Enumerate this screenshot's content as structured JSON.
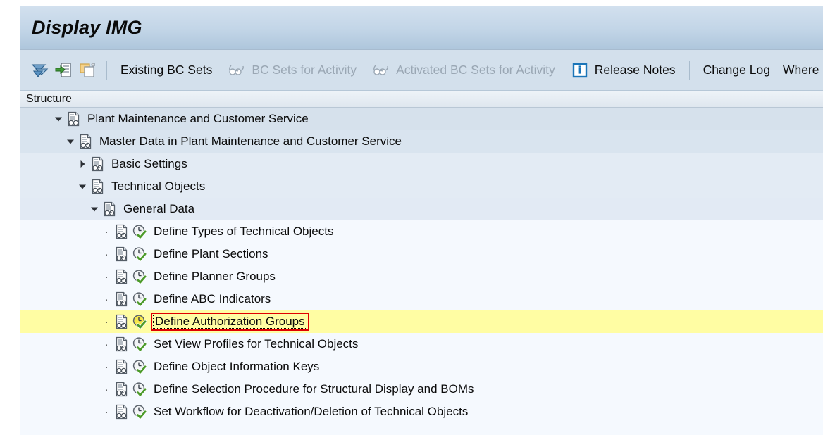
{
  "window": {
    "title": "Display IMG"
  },
  "toolbar": {
    "icons": [
      {
        "name": "filter-icon",
        "glyph": "filter"
      },
      {
        "name": "select-all-icon",
        "glyph": "select"
      },
      {
        "name": "copy-icon",
        "glyph": "copy"
      }
    ],
    "items": [
      {
        "label": "Existing BC Sets",
        "icon": null,
        "disabled": false
      },
      {
        "label": "BC Sets for Activity",
        "icon": "glasses-icon",
        "disabled": true
      },
      {
        "label": "Activated BC Sets for Activity",
        "icon": "glasses-icon",
        "disabled": true
      },
      {
        "label": "Release Notes",
        "icon": "info-icon",
        "disabled": false
      },
      {
        "label": "Change Log",
        "icon": null,
        "disabled": false
      },
      {
        "label": "Where",
        "icon": null,
        "disabled": false
      }
    ]
  },
  "columns": [
    {
      "label": "Structure"
    }
  ],
  "tree": {
    "rows": [
      {
        "label": "Plant Maintenance and Customer Service",
        "level": 0,
        "twisty": "expanded",
        "node_icon": "img-structure-icon",
        "activity_icon": null,
        "selected": false
      },
      {
        "label": "Master Data in Plant Maintenance and Customer Service",
        "level": 1,
        "twisty": "expanded",
        "node_icon": "img-structure-icon",
        "activity_icon": null,
        "selected": false
      },
      {
        "label": "Basic Settings",
        "level": 2,
        "twisty": "collapsed",
        "node_icon": "img-structure-icon",
        "activity_icon": null,
        "selected": false
      },
      {
        "label": "Technical Objects",
        "level": 2,
        "twisty": "expanded",
        "node_icon": "img-structure-icon",
        "activity_icon": null,
        "selected": false
      },
      {
        "label": "General Data",
        "level": 3,
        "twisty": "expanded",
        "node_icon": "img-structure-icon",
        "activity_icon": null,
        "selected": false
      },
      {
        "label": "Define Types of Technical Objects",
        "level": 4,
        "twisty": "leaf",
        "node_icon": "img-structure-icon",
        "activity_icon": "executable-activity-icon",
        "selected": false
      },
      {
        "label": "Define Plant Sections",
        "level": 4,
        "twisty": "leaf",
        "node_icon": "img-structure-icon",
        "activity_icon": "executable-activity-icon",
        "selected": false
      },
      {
        "label": "Define Planner Groups",
        "level": 4,
        "twisty": "leaf",
        "node_icon": "img-structure-icon",
        "activity_icon": "executable-activity-icon",
        "selected": false
      },
      {
        "label": "Define ABC Indicators",
        "level": 4,
        "twisty": "leaf",
        "node_icon": "img-structure-icon",
        "activity_icon": "executable-activity-icon",
        "selected": false
      },
      {
        "label": "Define Authorization Groups",
        "level": 4,
        "twisty": "leaf",
        "node_icon": "img-structure-icon",
        "activity_icon": "executable-activity-icon",
        "selected": true
      },
      {
        "label": "Set View Profiles for Technical Objects",
        "level": 4,
        "twisty": "leaf",
        "node_icon": "img-structure-icon",
        "activity_icon": "executable-activity-icon",
        "selected": false
      },
      {
        "label": "Define Object Information Keys",
        "level": 4,
        "twisty": "leaf",
        "node_icon": "img-structure-icon",
        "activity_icon": "executable-activity-icon",
        "selected": false
      },
      {
        "label": "Define Selection Procedure for Structural Display and BOMs",
        "level": 4,
        "twisty": "leaf",
        "node_icon": "img-structure-icon",
        "activity_icon": "executable-activity-icon",
        "selected": false
      },
      {
        "label": "Set Workflow for Deactivation/Deletion of Technical Objects",
        "level": 4,
        "twisty": "leaf",
        "node_icon": "img-structure-icon",
        "activity_icon": "executable-activity-icon",
        "selected": false
      }
    ]
  },
  "colors": {
    "title_gradient_top": "#d2e0ee",
    "title_gradient_bottom": "#aec6dc",
    "toolbar_bg": "#d3e0ec",
    "selection_highlight": "#fffda3",
    "selection_border": "#e00000",
    "accent_blue": "#1a75b8",
    "activity_green": "#4c9a2a"
  }
}
